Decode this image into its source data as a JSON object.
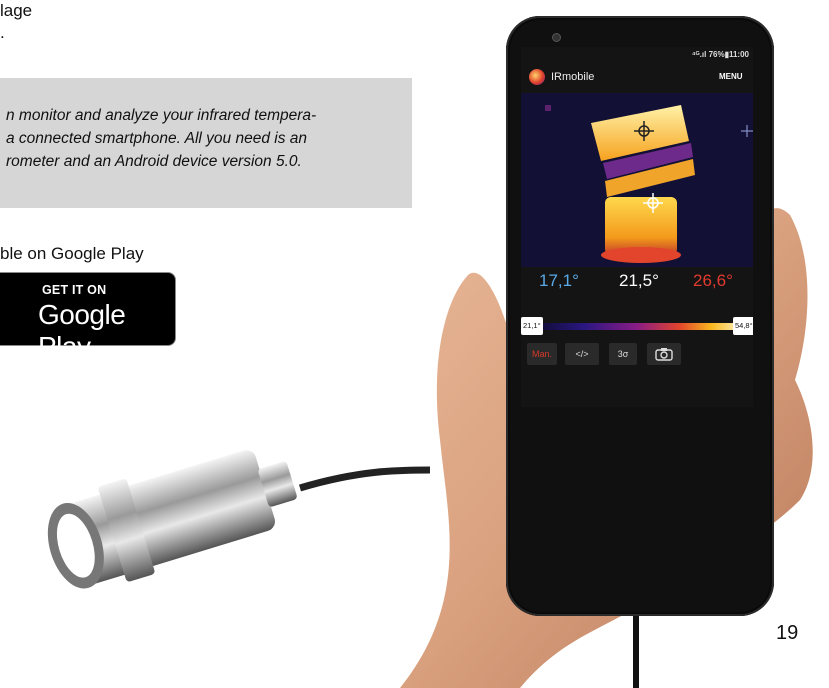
{
  "document": {
    "heading_lines": [
      "lage",
      "."
    ],
    "callout_lines": [
      "n monitor and analyze your infrared tempera-",
      "a connected smartphone. All you need is an",
      "rometer and an Android device version 5.0."
    ],
    "google_play_label": "ble on Google Play",
    "google_play_small": "GET IT ON",
    "google_play_big": "Google Play",
    "page_number": "19"
  },
  "phone": {
    "status_bar": "⁴ᴳ.ıl 76%▮11:00",
    "app_title": "IRmobile",
    "menu_label": "MENU",
    "temps": {
      "min": "17,1°",
      "center": "21,5°",
      "max": "26,6°"
    },
    "temp_colors": {
      "min": "#5aa9e6",
      "center": "#ffffff",
      "max": "#e23a2e"
    },
    "scale": {
      "low": "21,1°",
      "high": "54,8°"
    },
    "toolbar": {
      "mode": "Man.",
      "code": "</>",
      "sigma": "3σ",
      "camera_icon": "camera-icon"
    },
    "accent_color": "#d43a2a"
  }
}
